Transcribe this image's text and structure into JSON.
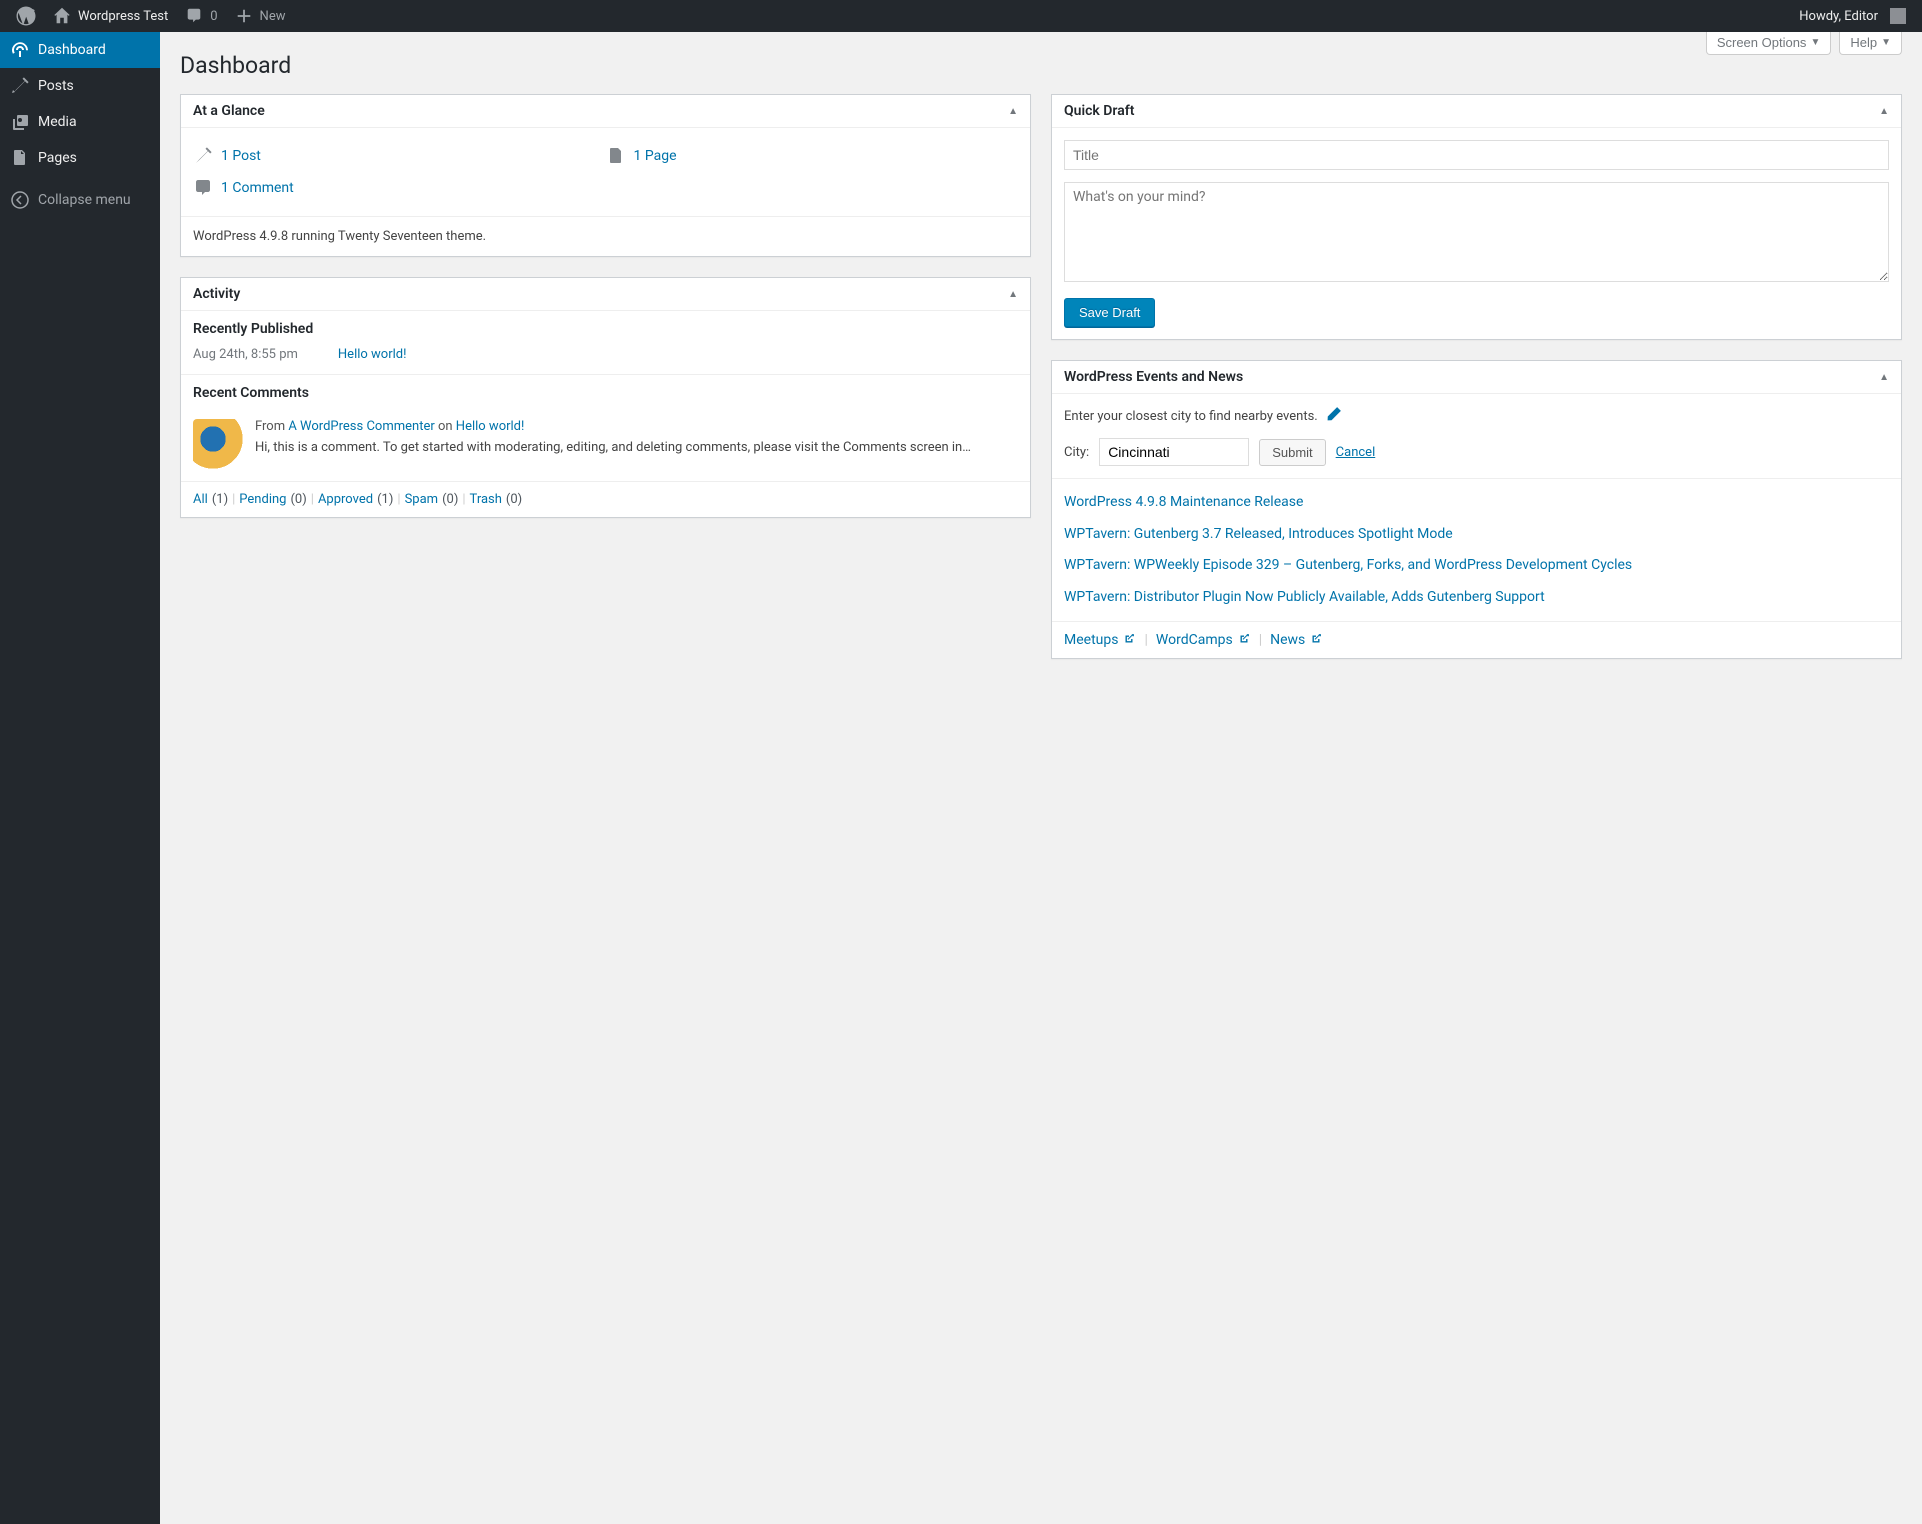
{
  "adminbar": {
    "site_name": "Wordpress Test",
    "comments_count": "0",
    "new_label": "New",
    "howdy": "Howdy, Editor"
  },
  "top_controls": {
    "screen_options": "Screen Options",
    "help": "Help"
  },
  "sidebar": {
    "items": [
      {
        "label": "Dashboard"
      },
      {
        "label": "Posts"
      },
      {
        "label": "Media"
      },
      {
        "label": "Pages"
      },
      {
        "label": "Collapse menu"
      }
    ]
  },
  "page": {
    "title": "Dashboard"
  },
  "glance": {
    "title": "At a Glance",
    "posts": "1 Post",
    "pages": "1 Page",
    "comments": "1 Comment",
    "version": "WordPress 4.9.8 running Twenty Seventeen theme."
  },
  "activity": {
    "title": "Activity",
    "published_head": "Recently Published",
    "pub_date": "Aug 24th, 8:55 pm",
    "pub_title": "Hello world!",
    "comments_head": "Recent Comments",
    "comment": {
      "from": "From ",
      "author": "A WordPress Commenter",
      "on": " on ",
      "post": "Hello world!",
      "excerpt": "Hi, this is a comment. To get started with moderating, editing, and deleting comments, please visit the Comments screen in…"
    },
    "filters": {
      "all": "All",
      "all_c": "(1)",
      "pending": "Pending",
      "pending_c": "(0)",
      "approved": "Approved",
      "approved_c": "(1)",
      "spam": "Spam",
      "spam_c": "(0)",
      "trash": "Trash",
      "trash_c": "(0)"
    }
  },
  "quickdraft": {
    "title": "Quick Draft",
    "title_placeholder": "Title",
    "content_placeholder": "What's on your mind?",
    "save_label": "Save Draft"
  },
  "events": {
    "title": "WordPress Events and News",
    "prompt": "Enter your closest city to find nearby events.",
    "city_label": "City:",
    "city_value": "Cincinnati",
    "submit": "Submit",
    "cancel": "Cancel",
    "news": [
      "WordPress 4.9.8 Maintenance Release",
      "WPTavern: Gutenberg 3.7 Released, Introduces Spotlight Mode",
      "WPTavern: WPWeekly Episode 329 – Gutenberg, Forks, and WordPress Development Cycles",
      "WPTavern: Distributor Plugin Now Publicly Available, Adds Gutenberg Support"
    ],
    "footer": {
      "meetups": "Meetups",
      "wordcamps": "WordCamps",
      "news": "News"
    }
  }
}
